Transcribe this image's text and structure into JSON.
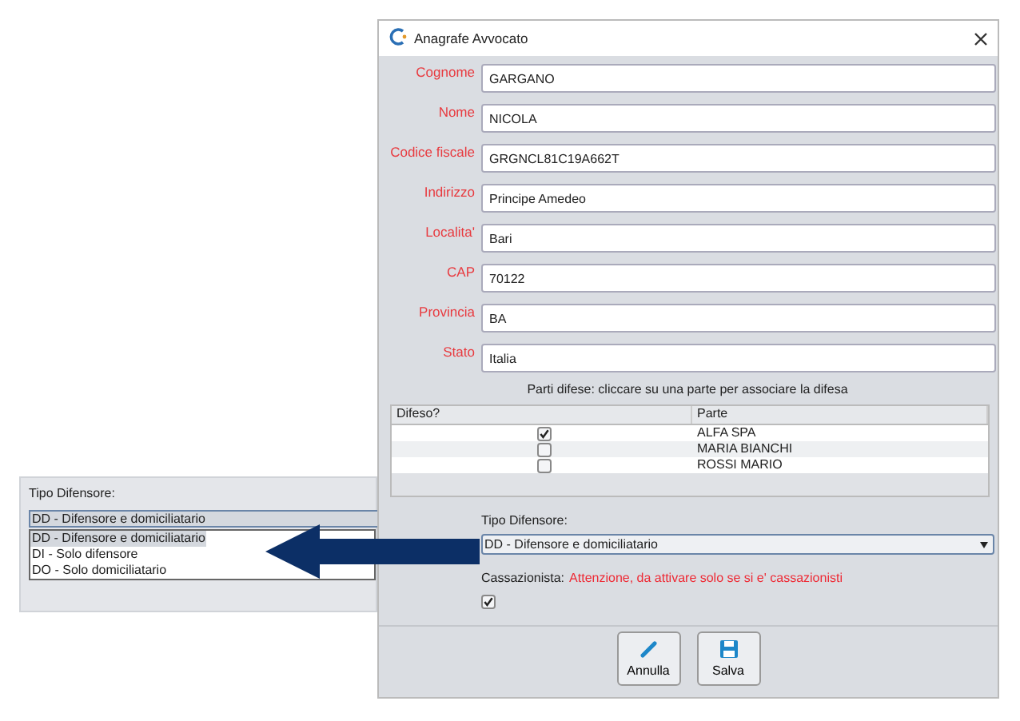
{
  "inset": {
    "label": "Tipo Difensore:",
    "combo_value": "DD - Difensore e domiciliatario",
    "options": [
      {
        "label": "DD - Difensore e domiciliatario",
        "selected": true
      },
      {
        "label": "DI - Solo difensore",
        "selected": false
      },
      {
        "label": "DO - Solo domiciliatario",
        "selected": false
      }
    ]
  },
  "dialog": {
    "title": "Anagrafe Avvocato",
    "fields": [
      {
        "label": "Cognome",
        "value": "GARGANO"
      },
      {
        "label": "Nome",
        "value": "NICOLA"
      },
      {
        "label": "Codice fiscale",
        "value": "GRGNCL81C19A662T"
      },
      {
        "label": "Indirizzo",
        "value": "Principe Amedeo"
      },
      {
        "label": "Localita'",
        "value": "Bari"
      },
      {
        "label": "CAP",
        "value": "70122"
      },
      {
        "label": "Provincia",
        "value": "BA"
      },
      {
        "label": "Stato",
        "value": "Italia"
      }
    ],
    "parties_hint": "Parti difese: cliccare su una parte per associare la difesa",
    "table": {
      "columns": [
        "Difeso?",
        "Parte"
      ],
      "rows": [
        {
          "checked": true,
          "party": "ALFA SPA"
        },
        {
          "checked": false,
          "party": "MARIA BIANCHI"
        },
        {
          "checked": false,
          "party": "ROSSI MARIO"
        }
      ]
    },
    "tipo_label": "Tipo Difensore:",
    "tipo_value": "DD - Difensore e domiciliatario",
    "cassazionista": {
      "label": "Cassazionista:",
      "warning": "Attenzione, da attivare solo se si e' cassazionisti",
      "checked": true
    },
    "buttons": [
      {
        "label": "Annulla",
        "kind": "edit"
      },
      {
        "label": "Salva",
        "kind": "save"
      }
    ]
  }
}
